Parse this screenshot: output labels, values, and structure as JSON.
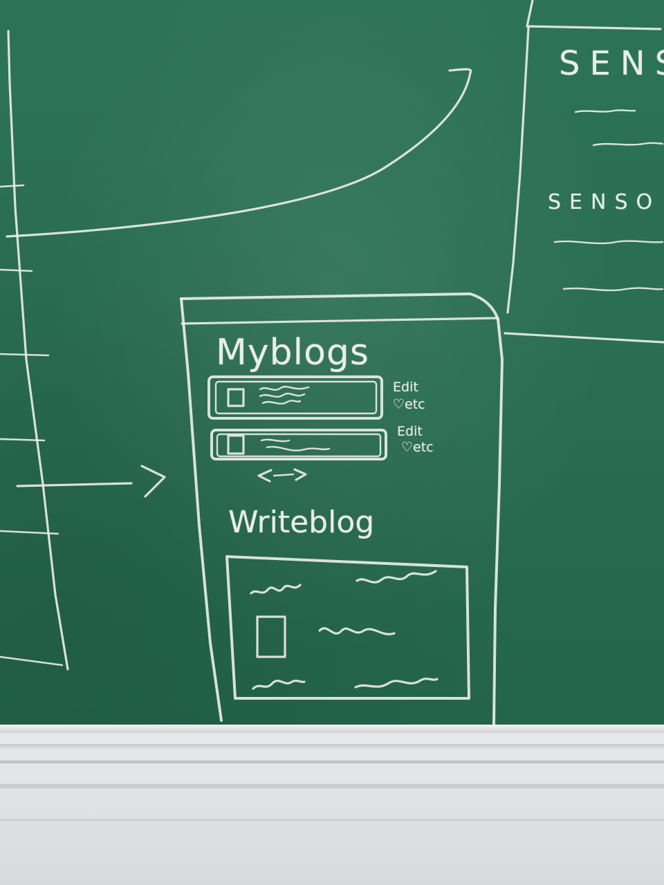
{
  "chalkboard": {
    "wireframe": {
      "my_blogs_title": "Myblogs",
      "blog_items": [
        {
          "edit_label": "Edit",
          "etc_label": "♡etc"
        },
        {
          "edit_label": "Edit",
          "etc_label": "♡etc"
        }
      ],
      "pager_glyph": "<>",
      "write_blog_title": "Writeblog"
    },
    "right_panel": {
      "heading_1": "SENS",
      "heading_2": "SENSO"
    }
  },
  "colors": {
    "board": "#2a6e54",
    "chalk": "#eef1ec",
    "tray": "#dcdedf"
  }
}
